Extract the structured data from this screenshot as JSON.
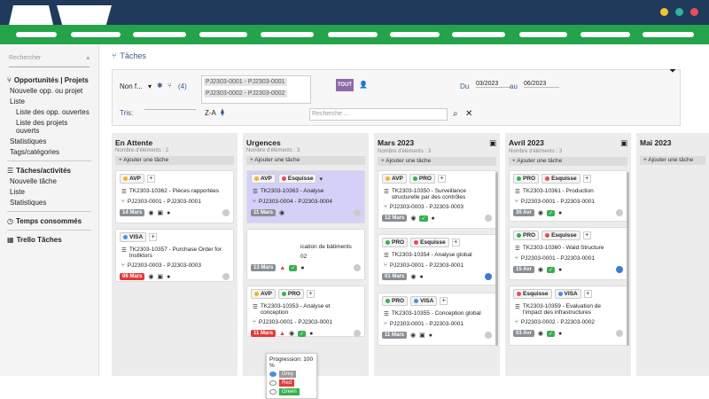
{
  "sidebar": {
    "search": "Rechercher",
    "sections": [
      {
        "head": "Opportunités | Projets",
        "items": [
          "Nouvelle opp. ou projet",
          "Liste",
          "Liste des opp. ouvertes",
          "Liste des projets ouverts",
          "Statistiques",
          "Tags/catégories"
        ]
      },
      {
        "head": "Tâches/activités",
        "items": [
          "Nouvelle tâche",
          "Liste",
          "Statistiques"
        ]
      },
      {
        "head": "Temps consommés",
        "items": []
      },
      {
        "head": "Trello Tâches",
        "items": []
      }
    ]
  },
  "page_title": "Tâches",
  "filters": {
    "non": "Non f...",
    "count": "(4)",
    "chips": [
      "PJ2303-0001 - PJ2303-0001",
      "PJ2303-0002 - PJ2303-0002"
    ],
    "tout": "TOUT",
    "du": "Du",
    "date_from": "03/2023",
    "au": "au",
    "date_to": "06/2023",
    "tris": "Tris:",
    "za": "Z-A",
    "search_ph": "Recherche ..."
  },
  "columns": [
    {
      "title": "En Attente",
      "count": "Nombre d'éléments : 2",
      "add": "+ Ajouter une tâche"
    },
    {
      "title": "Urgences",
      "count": "Nombre d'éléments : 3",
      "add": "+ Ajouter une tâche"
    },
    {
      "title": "Mars 2023",
      "count": "Nombre d'éléments : 3",
      "add": "+ Ajouter une tâche"
    },
    {
      "title": "Avril 2023",
      "count": "Nombre d'éléments : 3",
      "add": "+ Ajouter une tâche"
    },
    {
      "title": "Mai 2023",
      "count": "",
      "add": "+ Ajouter une tâche"
    }
  ],
  "cards": {
    "c1": {
      "tags": [
        "AVP"
      ],
      "task": "TK2303-10362 - Pièces rapportées",
      "proj": "PJ2303-0001 - PJ2303-0001",
      "date": "14 Mars"
    },
    "c2": {
      "tags": [
        "VISA"
      ],
      "task": "TK2303-10357 - Purchase Order for Instlktors",
      "proj": "PJ2303-0003 - PJ2303-0003",
      "date": "06 Mars"
    },
    "c3": {
      "tags": [
        "AVP",
        "Esquisse"
      ],
      "task": "TK2303-10363 - Analyse",
      "proj": "PJ2303-0004 - PJ2303-0004",
      "date": "11 Mars"
    },
    "c4": {
      "tags": [],
      "task": "ication de bâtiments",
      "proj": "02",
      "date": "13 Mars"
    },
    "c5": {
      "tags": [
        "AVP",
        "PRO"
      ],
      "task": "TK2303-10353 - Analyse et conception",
      "proj": "PJ2303-0001 - PJ2303-0001",
      "date": "11 Mars"
    },
    "c6": {
      "tags": [
        "AVP",
        "PRO"
      ],
      "task": "TK2303-10350 - Surveillance structurelle par des contrôles",
      "proj": "PJ2303-0003 - PJ2303-0003",
      "date": "12 Mars"
    },
    "c7": {
      "tags": [
        "PRO",
        "Esquisse"
      ],
      "task": "TK2303-10354 - Analyse global",
      "proj": "PJ2303-0001 - PJ2303-0001",
      "date": "01 Mars"
    },
    "c8": {
      "tags": [
        "PRO",
        "VISA"
      ],
      "task": "TK2303-10355 - Conception global",
      "proj": "PJ2303-0001 - PJ2303-0001",
      "date": "11 Mars"
    },
    "c9": {
      "tags": [
        "PRO",
        "Esquisse"
      ],
      "task": "TK2303-10361 - Production",
      "proj": "PJ2303-0001 - PJ2303-0001",
      "date": "30 Avr"
    },
    "c10": {
      "tags": [
        "PRO",
        "Esquisse"
      ],
      "task": "TK2303-10360 - Wald Structure",
      "proj": "PJ2303-0001 - PJ2303-0001",
      "date": "15 Avr"
    },
    "c11": {
      "tags": [
        "Esquisse",
        "VISA"
      ],
      "task": "TK2303-10359 - Evaluation de l'impact des infrastructures",
      "proj": "PJ2303-0002 - PJ2303-0002",
      "date": "03 Avr"
    }
  },
  "popup": {
    "label": "Progression: 100 %",
    "opts": [
      "Grey",
      "Red",
      "Green"
    ]
  },
  "colors": {
    "header": "#1f3a5b",
    "nav": "#23a34a",
    "accent": "#3a5b85"
  }
}
